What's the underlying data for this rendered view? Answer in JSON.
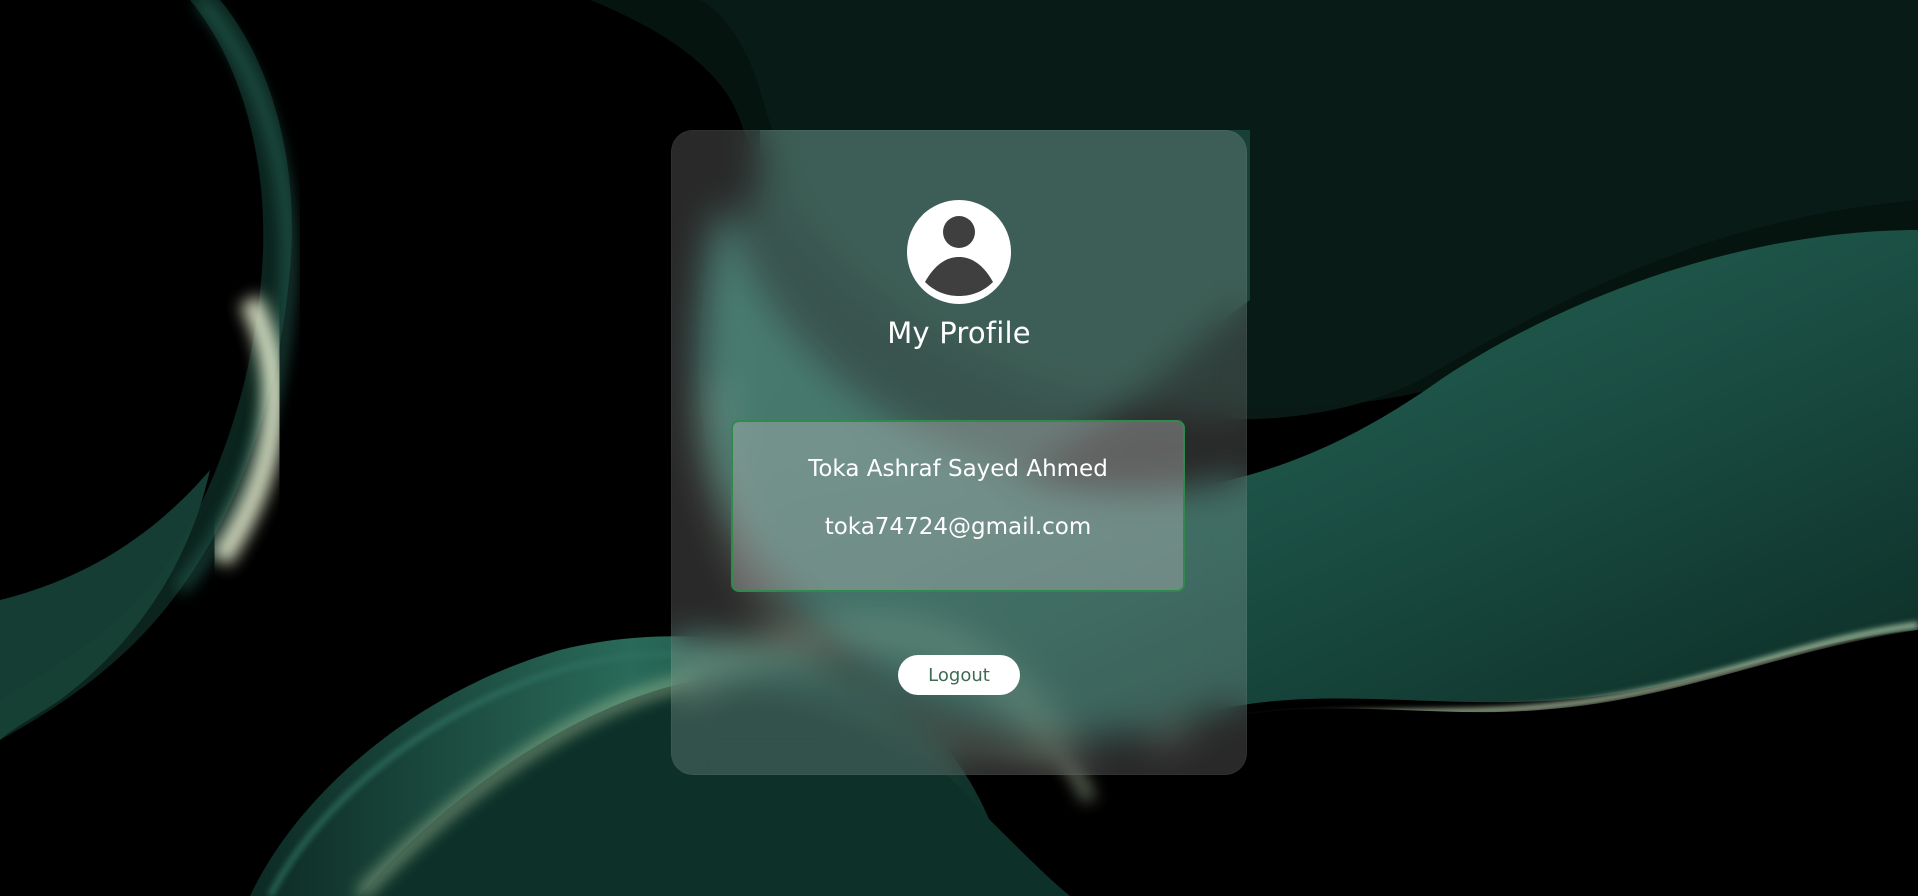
{
  "profile": {
    "title": "My Profile",
    "avatar_icon": "user-circle-icon",
    "name": "Toka Ashraf Sayed Ahmed",
    "email": "toka74724@gmail.com",
    "logout_label": "Logout"
  },
  "theme": {
    "background": "#000000",
    "accent_green": "#2f8a4c",
    "button_text": "#3e6b56"
  }
}
